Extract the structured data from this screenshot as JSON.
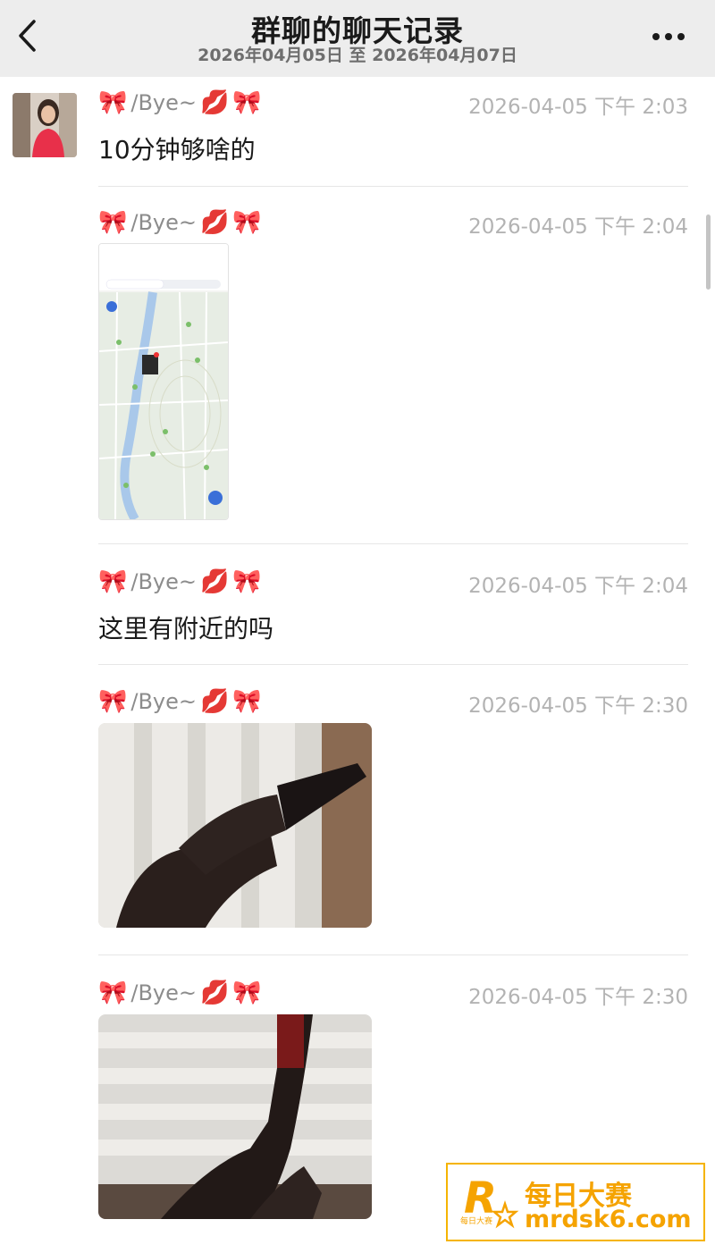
{
  "header": {
    "title": "群聊的聊天记录",
    "date_range": "2026年04月05日 至 2026年04月07日"
  },
  "sender": {
    "name": "/Bye~",
    "emoji_bow": "🎀",
    "emoji_kiss": "💋"
  },
  "messages": [
    {
      "time": "2026-04-05 下午 2:03",
      "type": "text",
      "text": "10分钟够啥的"
    },
    {
      "time": "2026-04-05 下午 2:04",
      "type": "image",
      "image": "map-screenshot"
    },
    {
      "time": "2026-04-05 下午 2:04",
      "type": "text",
      "text": "这里有附近的吗"
    },
    {
      "time": "2026-04-05 下午 2:30",
      "type": "image",
      "image": "photo"
    },
    {
      "time": "2026-04-05 下午 2:30",
      "type": "image",
      "image": "photo"
    }
  ],
  "watermark": {
    "logo_letter": "R",
    "logo_small": "每日大赛",
    "line1": "每日大赛",
    "line2": "mrdsk6.com"
  },
  "colors": {
    "header_bg": "#ededed",
    "timestamp": "#b3b3b3",
    "watermark_accent": "#f5a300"
  }
}
